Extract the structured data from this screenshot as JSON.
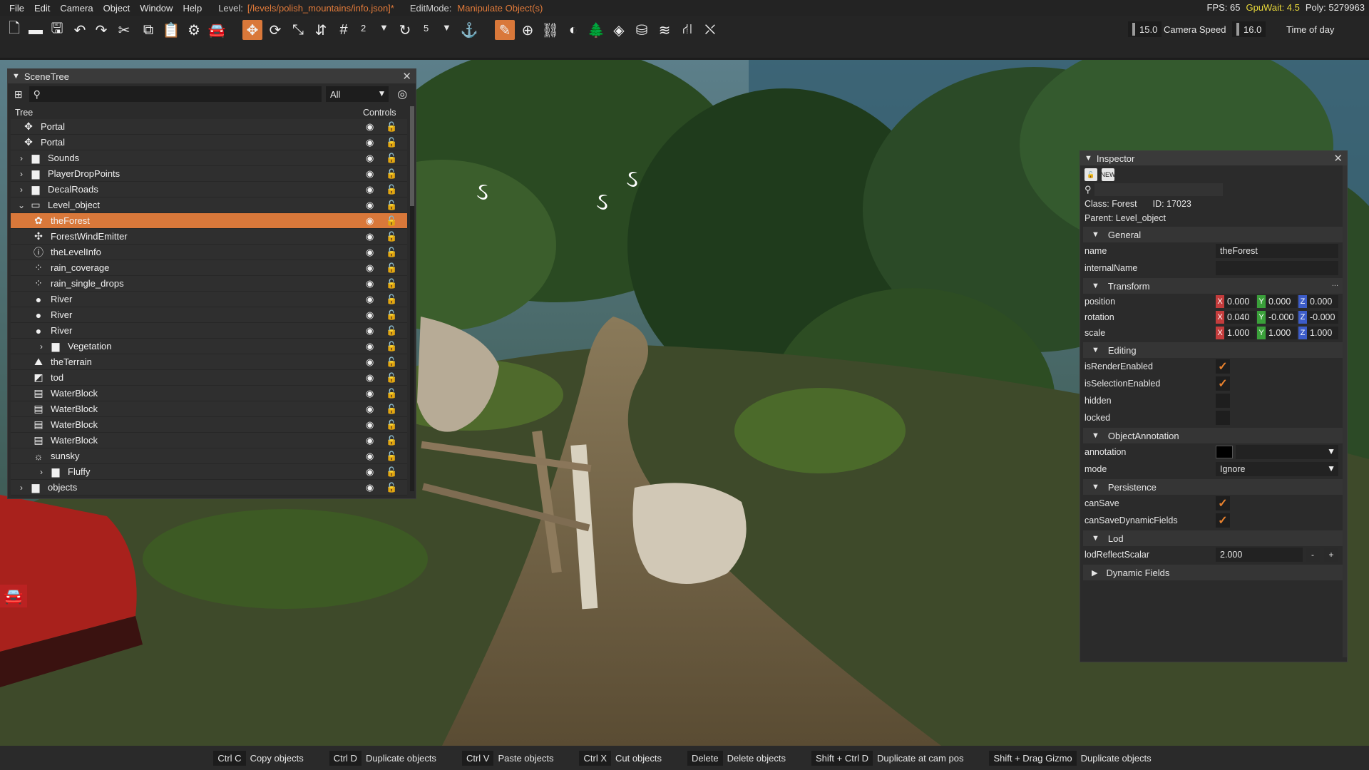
{
  "menubar": {
    "items": [
      "File",
      "Edit",
      "Camera",
      "Object",
      "Window",
      "Help"
    ],
    "level_label": "Level:",
    "level_value": "[/levels/polish_mountains/info.json]*",
    "edit_label": "EditMode:",
    "edit_value": "Manipulate Object(s)",
    "fps": "FPS: 65",
    "gpu": "GpuWait: 4.5",
    "poly": "Poly: 5279963"
  },
  "toolbar": {
    "snap_value": "2",
    "rotate_snap_value": "5",
    "camera_speed_value": "15.0",
    "camera_speed_label": "Camera Speed",
    "time_of_day_value": "16.0",
    "time_of_day_label": "Time of day",
    "active_color": "#d9783a"
  },
  "scenetree": {
    "title": "SceneTree",
    "filter_value": "All",
    "col_tree": "Tree",
    "col_controls": "Controls",
    "rows": [
      {
        "label": "Portal",
        "icon": "portal-icon",
        "glyph": "✥",
        "chevron": "",
        "indent": 0
      },
      {
        "label": "Portal",
        "icon": "portal-icon",
        "glyph": "✥",
        "chevron": "",
        "indent": 0
      },
      {
        "label": "Sounds",
        "icon": "folder-icon",
        "glyph": "▆",
        "chevron": "›",
        "indent": 0
      },
      {
        "label": "PlayerDropPoints",
        "icon": "folder-icon",
        "glyph": "▆",
        "chevron": "›",
        "indent": 0
      },
      {
        "label": "DecalRoads",
        "icon": "folder-icon",
        "glyph": "▆",
        "chevron": "›",
        "indent": 0
      },
      {
        "label": "Level_object",
        "icon": "folder-open-icon",
        "glyph": "▭",
        "chevron": "⌄",
        "indent": 0
      },
      {
        "label": "theForest",
        "icon": "forest-icon",
        "glyph": "✿",
        "chevron": "",
        "indent": 1,
        "selected": true
      },
      {
        "label": "ForestWindEmitter",
        "icon": "wind-emitter-icon",
        "glyph": "✣",
        "chevron": "",
        "indent": 1
      },
      {
        "label": "theLevelInfo",
        "icon": "info-icon",
        "glyph": "ⓘ",
        "chevron": "",
        "indent": 1
      },
      {
        "label": "rain_coverage",
        "icon": "rain-icon",
        "glyph": "⁘",
        "chevron": "",
        "indent": 1
      },
      {
        "label": "rain_single_drops",
        "icon": "rain-icon",
        "glyph": "⁘",
        "chevron": "",
        "indent": 1
      },
      {
        "label": "River",
        "icon": "river-icon",
        "glyph": "●",
        "chevron": "",
        "indent": 1
      },
      {
        "label": "River",
        "icon": "river-icon",
        "glyph": "●",
        "chevron": "",
        "indent": 1
      },
      {
        "label": "River",
        "icon": "river-icon",
        "glyph": "●",
        "chevron": "",
        "indent": 1
      },
      {
        "label": "Vegetation",
        "icon": "folder-icon",
        "glyph": "▆",
        "chevron": "›",
        "indent": 2
      },
      {
        "label": "theTerrain",
        "icon": "terrain-icon",
        "glyph": "⛰",
        "chevron": "",
        "indent": 1
      },
      {
        "label": "tod",
        "icon": "tod-icon",
        "glyph": "◩",
        "chevron": "",
        "indent": 1
      },
      {
        "label": "WaterBlock",
        "icon": "water-block-icon",
        "glyph": "▤",
        "chevron": "",
        "indent": 1
      },
      {
        "label": "WaterBlock",
        "icon": "water-block-icon",
        "glyph": "▤",
        "chevron": "",
        "indent": 1
      },
      {
        "label": "WaterBlock",
        "icon": "water-block-icon",
        "glyph": "▤",
        "chevron": "",
        "indent": 1
      },
      {
        "label": "WaterBlock",
        "icon": "water-block-icon",
        "glyph": "▤",
        "chevron": "",
        "indent": 1
      },
      {
        "label": "sunsky",
        "icon": "sunsky-icon",
        "glyph": "☼",
        "chevron": "",
        "indent": 1
      },
      {
        "label": "Fluffy",
        "icon": "folder-icon",
        "glyph": "▆",
        "chevron": "›",
        "indent": 2
      },
      {
        "label": "objects",
        "icon": "folder-icon",
        "glyph": "▆",
        "chevron": "›",
        "indent": 0
      }
    ]
  },
  "inspector": {
    "title": "Inspector",
    "class_text": "Class: Forest",
    "id_text": "ID: 17023",
    "parent_text": "Parent: Level_object",
    "sections": {
      "general": "General",
      "transform": "Transform",
      "editing": "Editing",
      "annotation": "ObjectAnnotation",
      "persistence": "Persistence",
      "lod": "Lod",
      "dynamic": "Dynamic Fields"
    },
    "fields": {
      "name_key": "name",
      "name_value": "theForest",
      "internal_key": "internalName",
      "position_key": "position",
      "position": [
        "0.000",
        "0.000",
        "0.000"
      ],
      "rotation_key": "rotation",
      "rotation": [
        "0.040",
        "-0.000",
        "-0.000"
      ],
      "scale_key": "scale",
      "scale": [
        "1.000",
        "1.000",
        "1.000"
      ],
      "isRenderEnabled_key": "isRenderEnabled",
      "isSelectionEnabled_key": "isSelectionEnabled",
      "hidden_key": "hidden",
      "locked_key": "locked",
      "annotation_key": "annotation",
      "mode_key": "mode",
      "mode_value": "Ignore",
      "canSave_key": "canSave",
      "canSaveDynamic_key": "canSaveDynamicFields",
      "lod_key": "lodReflectScalar",
      "lod_value": "2.000",
      "axis_x": "X",
      "axis_y": "Y",
      "axis_z": "Z"
    }
  },
  "shortcuts": [
    {
      "key": "Ctrl C",
      "desc": "Copy objects"
    },
    {
      "key": "Ctrl D",
      "desc": "Duplicate objects"
    },
    {
      "key": "Ctrl V",
      "desc": "Paste objects"
    },
    {
      "key": "Ctrl X",
      "desc": "Cut objects"
    },
    {
      "key": "Delete",
      "desc": "Delete objects"
    },
    {
      "key": "Shift + Ctrl D",
      "desc": "Duplicate at cam pos"
    },
    {
      "key": "Shift + Drag Gizmo",
      "desc": "Duplicate objects"
    }
  ]
}
